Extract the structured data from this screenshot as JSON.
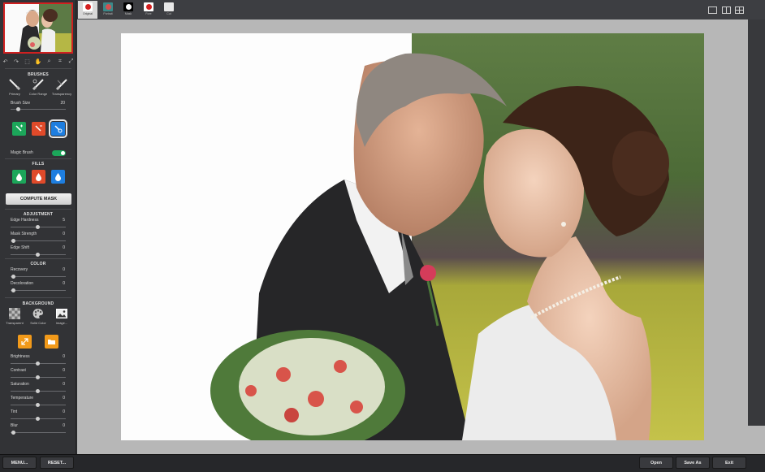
{
  "sidebar": {
    "brushes_title": "BRUSHES",
    "brush_tools": [
      {
        "label": "Primary",
        "icon": "brush-icon"
      },
      {
        "label": "Color Range",
        "icon": "color-range-brush-icon"
      },
      {
        "label": "Transparency",
        "icon": "transparency-brush-icon"
      }
    ],
    "brush_size": {
      "label": "Brush Size",
      "value": "20"
    },
    "magic_brush": {
      "label": "Magic Brush",
      "on": true
    },
    "fills_title": "FILLS",
    "compute_mask": "COMPUTE MASK",
    "adjustment_title": "ADJUSTMENT",
    "adjustment": [
      {
        "label": "Edge Hardness",
        "value": "5"
      },
      {
        "label": "Mask Strength",
        "value": "0"
      },
      {
        "label": "Edge Shift",
        "value": "0"
      }
    ],
    "color_title": "COLOR",
    "color": [
      {
        "label": "Recovery",
        "value": "0"
      },
      {
        "label": "Decoloration",
        "value": "0"
      }
    ],
    "background_title": "BACKGROUND",
    "background_options": [
      {
        "label": "Transparent",
        "icon": "checkerboard-icon"
      },
      {
        "label": "Solid Color",
        "icon": "palette-icon"
      },
      {
        "label": "Image...",
        "icon": "image-icon"
      }
    ],
    "bg_adjust": [
      {
        "label": "Brightness",
        "value": "0"
      },
      {
        "label": "Contrast",
        "value": "0"
      },
      {
        "label": "Saturation",
        "value": "0"
      },
      {
        "label": "Temperature",
        "value": "0"
      },
      {
        "label": "Tint",
        "value": "0"
      },
      {
        "label": "Blur",
        "value": "0"
      }
    ]
  },
  "view_tabs": [
    {
      "label": "Original",
      "icon": "apple-icon",
      "active": true
    },
    {
      "label": "Portrait",
      "icon": "portrait-icon",
      "active": false
    },
    {
      "label": "Mask",
      "icon": "mask-icon",
      "active": false
    },
    {
      "label": "Fore",
      "icon": "apple-icon",
      "active": false
    },
    {
      "label": "Cut",
      "icon": "cut-icon",
      "active": false
    }
  ],
  "bottom": {
    "menu": "MENU...",
    "reset": "RESET...",
    "open": "Open",
    "save_as": "Save As",
    "exit": "Exit"
  },
  "colors": {
    "accent_green": "#1ca65a",
    "accent_red": "#e04a2a",
    "accent_blue": "#1e7ee0",
    "accent_orange": "#f29a1a"
  }
}
